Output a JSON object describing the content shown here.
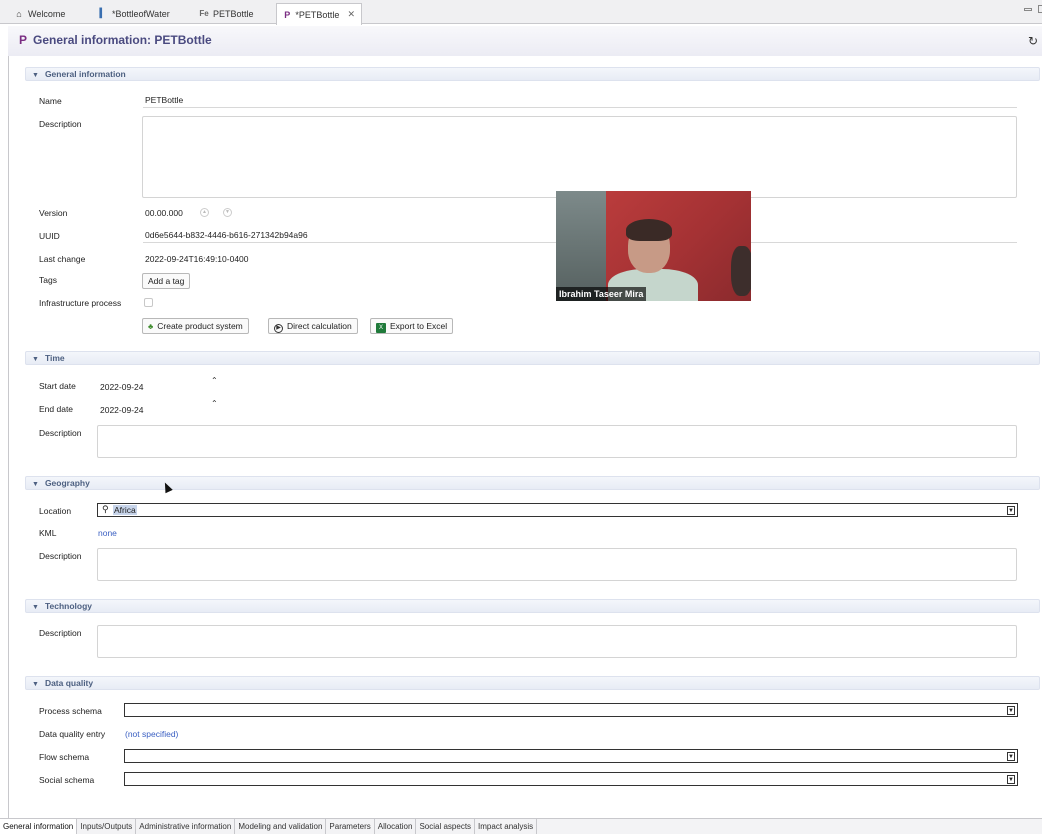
{
  "editor_tabs": [
    {
      "icon": "home-icon",
      "label": "Welcome"
    },
    {
      "icon": "bar-chart-icon",
      "label": "*BottleofWater"
    },
    {
      "icon": "flow-editor-icon",
      "label": "PETBottle"
    },
    {
      "icon": "process-icon",
      "label": "*PETBottle",
      "close": "✕"
    }
  ],
  "header": {
    "title": "General information: PETBottle",
    "prefix": "P"
  },
  "general": {
    "section_title": "General information",
    "name_label": "Name",
    "name_value": "PETBottle",
    "description_label": "Description",
    "version_label": "Version",
    "version_value": "00.00.000",
    "uuid_label": "UUID",
    "uuid_value": "0d6e5644-b832-4446-b616-271342b94a96",
    "last_change_label": "Last change",
    "last_change_value": "2022-09-24T16:49:10-0400",
    "tags_label": "Tags",
    "add_tag_label": "Add a tag",
    "infra_label": "Infrastructure process",
    "buttons": {
      "create_product_system": "Create product system",
      "direct_calculation": "Direct calculation",
      "export_excel": "Export to Excel"
    }
  },
  "time": {
    "section_title": "Time",
    "start_label": "Start date",
    "start_value": "2022-09-24",
    "end_label": "End date",
    "end_value": "2022-09-24",
    "description_label": "Description"
  },
  "geography": {
    "section_title": "Geography",
    "location_label": "Location",
    "location_value": "Africa",
    "kml_label": "KML",
    "kml_value": "none",
    "description_label": "Description"
  },
  "technology": {
    "section_title": "Technology",
    "description_label": "Description"
  },
  "data_quality": {
    "section_title": "Data quality",
    "process_schema_label": "Process schema",
    "dq_entry_label": "Data quality entry",
    "dq_entry_value": "(not specified)",
    "flow_schema_label": "Flow schema",
    "social_schema_label": "Social schema"
  },
  "video_overlay": {
    "name": "Ibrahim Taseer Mira"
  },
  "page_tabs": [
    "General information",
    "Inputs/Outputs",
    "Administrative information",
    "Modeling and validation",
    "Parameters",
    "Allocation",
    "Social aspects",
    "Impact analysis"
  ]
}
